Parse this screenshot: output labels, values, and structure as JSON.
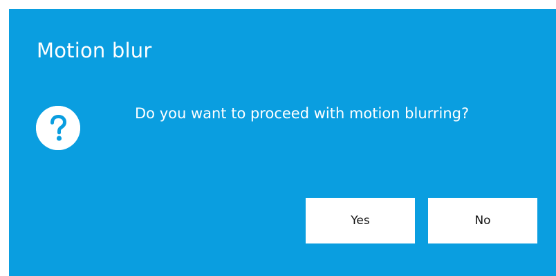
{
  "dialog": {
    "title": "Motion blur",
    "message": "Do you want to proceed with motion blurring?",
    "icon": "question-icon",
    "buttons": {
      "yes_label": "Yes",
      "no_label": "No"
    }
  },
  "colors": {
    "background": "#0a9ee0",
    "text": "#ffffff",
    "button_background": "#ffffff",
    "button_text": "#111111",
    "icon_glyph": "#0a9ee0"
  }
}
